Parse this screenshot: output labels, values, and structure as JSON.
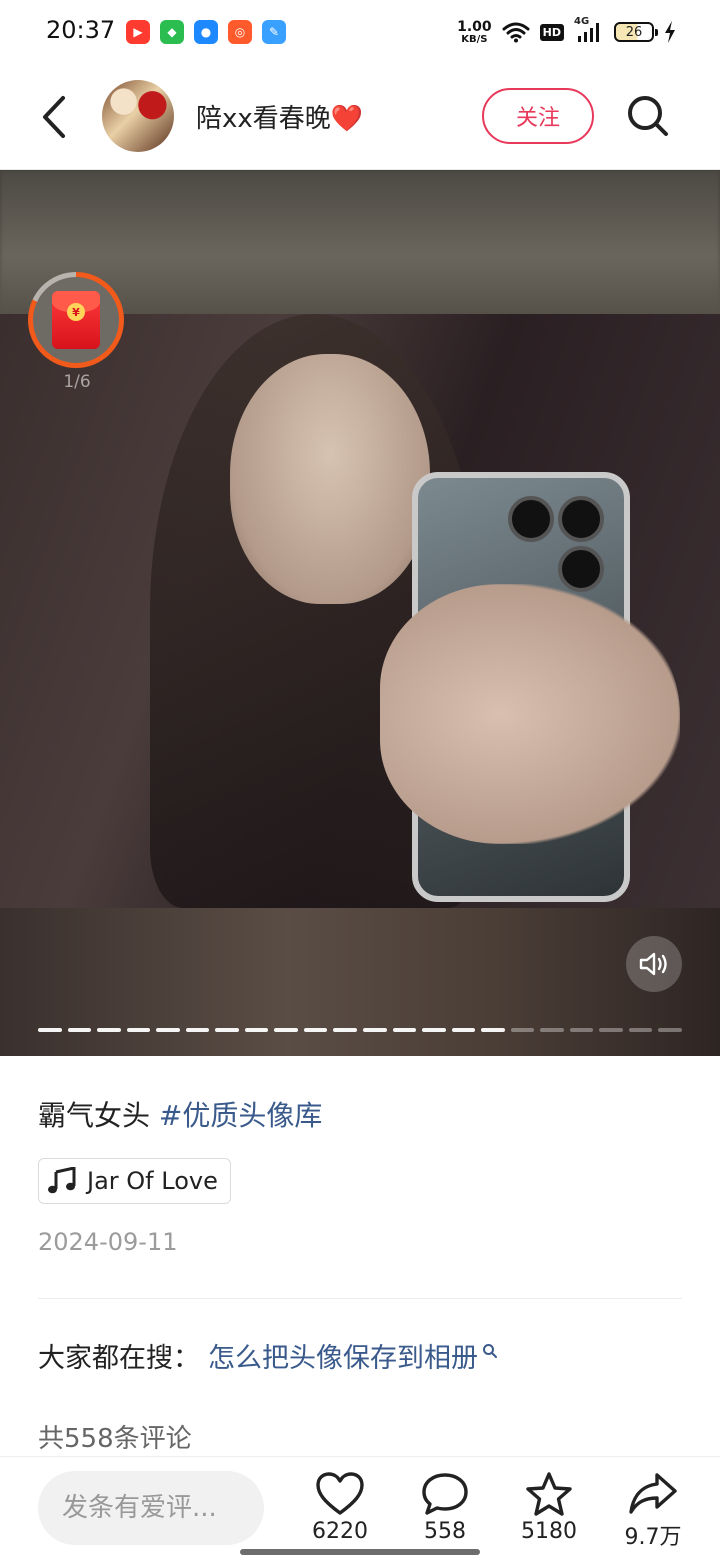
{
  "status_bar": {
    "time": "20:37",
    "net_speed_value": "1.00",
    "net_speed_unit": "KB/S",
    "hd_label": "HD",
    "signal_label": "4G",
    "battery": "26"
  },
  "header": {
    "username": "陪xx看春晚❤️",
    "follow_label": "关注"
  },
  "media": {
    "page_indicator": "1/6",
    "coin_symbol": "¥",
    "progress": {
      "total_segments": 22,
      "active_segments": 16
    }
  },
  "post": {
    "caption_text": "霸气女头 ",
    "hashtag": "#优质头像库",
    "music_title": "Jar Of Love",
    "date": "2024-09-11"
  },
  "search_suggestion": {
    "label": "大家都在搜：",
    "query": "怎么把头像保存到相册"
  },
  "comments": {
    "count_label": "共558条评论"
  },
  "bottom_bar": {
    "comment_placeholder": "发条有爱评...",
    "likes": "6220",
    "comments": "558",
    "favorites": "5180",
    "shares": "9.7万"
  },
  "colors": {
    "accent": "#e8395b",
    "link": "#3a5a8c",
    "red_packet": "#d8121b"
  }
}
